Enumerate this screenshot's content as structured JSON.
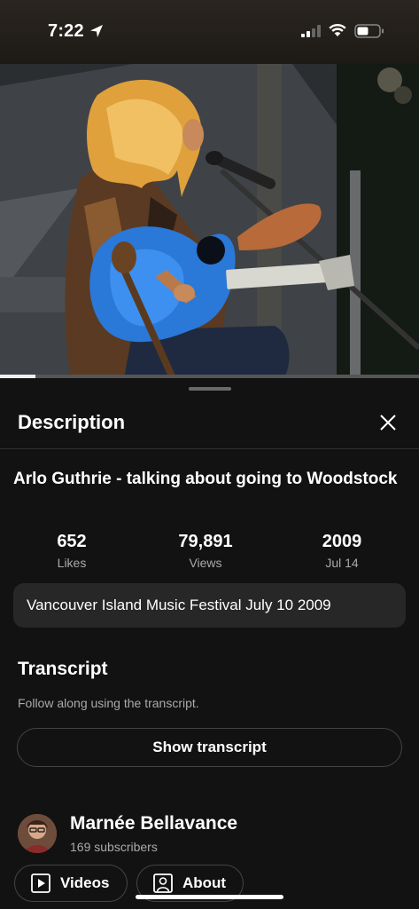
{
  "status_bar": {
    "time": "7:22",
    "icons": [
      "location-arrow-icon",
      "signal-icon",
      "wifi-icon",
      "battery-icon"
    ]
  },
  "video": {
    "progress_fraction": 0.085
  },
  "sheet": {
    "title": "Description",
    "video_title": "Arlo Guthrie - talking about going to Woodstock",
    "stats": [
      {
        "value": "652",
        "label": "Likes"
      },
      {
        "value": "79,891",
        "label": "Views"
      },
      {
        "value": "2009",
        "label": "Jul 14"
      }
    ],
    "description": "Vancouver Island Music Festival July 10 2009",
    "transcript": {
      "title": "Transcript",
      "subtitle": "Follow along using the transcript.",
      "button_label": "Show transcript"
    },
    "channel": {
      "name": "Marnée Bellavance",
      "subscribers": "169 subscribers"
    },
    "chips": [
      {
        "label": "Videos",
        "icon": "play-square-icon"
      },
      {
        "label": "About",
        "icon": "person-square-icon"
      }
    ]
  },
  "colors": {
    "background": "#0f0f0f",
    "surface": "#272727",
    "secondary_text": "#aaaaaa",
    "guitar_blue": "#2a78d8",
    "hair_gold": "#e0a03c"
  }
}
